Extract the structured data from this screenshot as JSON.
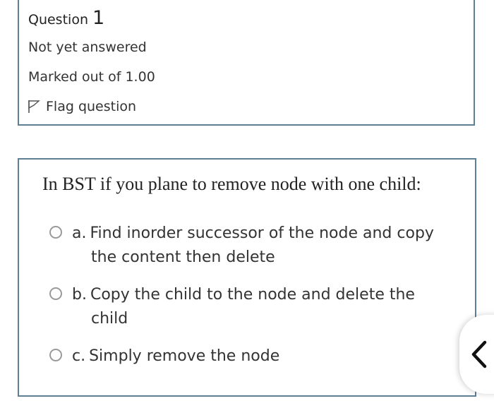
{
  "question_info": {
    "title_prefix": "Question",
    "number": "1",
    "status": "Not yet answered",
    "marks": "Marked out of 1.00",
    "flag_label": "Flag question"
  },
  "question": {
    "prompt": "In BST if you plane to remove node with one child:",
    "options": [
      {
        "prefix": "a.",
        "line1": "Find inorder successor of the node and copy",
        "line2": "the content then delete"
      },
      {
        "prefix": "b.",
        "line1": "Copy the child to the node and delete the",
        "line2": "child"
      },
      {
        "prefix": "c.",
        "line1": "Simply remove the node",
        "line2": ""
      }
    ]
  },
  "icons": {
    "flag": "flag-outline-icon",
    "back": "chevron-left-icon"
  },
  "colors": {
    "border": "#5f7f95",
    "radio_border": "#9a9a9a"
  }
}
